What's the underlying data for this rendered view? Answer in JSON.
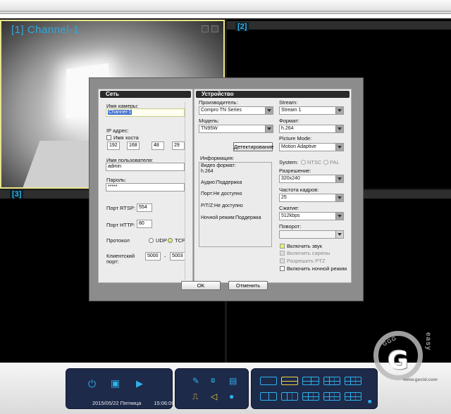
{
  "grid": {
    "cell1_label": "[1] Channel-1",
    "cell2_label": "[2]",
    "cell3_label": "[3]"
  },
  "dialog": {
    "network": {
      "title": "Сеть",
      "camera_name_label": "Имя камеры:",
      "camera_name_value": "Channel-1",
      "ip_label": "IP адрес:",
      "hostname_label": "Имя хоста",
      "ip": [
        "192",
        "168",
        "48",
        "29"
      ],
      "username_label": "Имя пользователя:",
      "username_value": "admin",
      "password_label": "Пароль:",
      "password_value": "*****",
      "rtsp_label": "Порт RTSP:",
      "rtsp_value": "554",
      "http_label": "Порт HTTP:",
      "http_value": "80",
      "protocol_label": "Протокол",
      "udp_label": "UDP",
      "tcp_label": "TCP",
      "client_port_label_1": "Клиентский",
      "client_port_label_2": "порт:",
      "client_port_from": "5000",
      "client_port_to": "5003",
      "dash": "-"
    },
    "device": {
      "title": "Устройство",
      "manufacturer_label": "Производитель:",
      "manufacturer_value": "Compro TN Series",
      "model_label": "Модель:",
      "model_value": "TN95W",
      "detect_button": "Детектирование",
      "info_label": "Информация:",
      "info_lines": [
        "Видео формат:",
        "h.264",
        "Аудио:Поддержка",
        "Порт:Не доступно",
        "P/T/Z:Не доступно",
        "Ночной режим:Поддержка"
      ],
      "stream_label": "Stream:",
      "stream_value": "Stream 1",
      "format_label": "Формат:",
      "format_value": "h.264",
      "picture_mode_label": "Picture Mode:",
      "picture_mode_value": "Motion Adaptive",
      "system_label": "System:",
      "ntsc_label": "NTSC",
      "pal_label": "PAL",
      "resolution_label": "Разрешение:",
      "resolution_value": "320x240",
      "fps_label": "Частота кадров:",
      "fps_value": "25",
      "compression_label": "Сжатие:",
      "compression_value": "512kbps",
      "rotation_label": "Поворот:",
      "rotation_value": "",
      "enable_sound": "Включить звук",
      "enable_alarms": "Включить сирены",
      "allow_ptz": "Разрешить PTZ",
      "enable_night": "Включить ночной режим"
    },
    "ok_button": "OK",
    "cancel_button": "Отменить"
  },
  "footer": {
    "date": "2015/05/22 Пятница",
    "time": "15:06:00"
  },
  "watermark": {
    "ring_text": "GGG",
    "vertical_text": "easy",
    "site": "www.gecid.com"
  },
  "colors": {
    "accent_blue": "#2fb0ea",
    "accent_yellow": "#f0d23a",
    "control_bg": "#1d2a4a"
  }
}
